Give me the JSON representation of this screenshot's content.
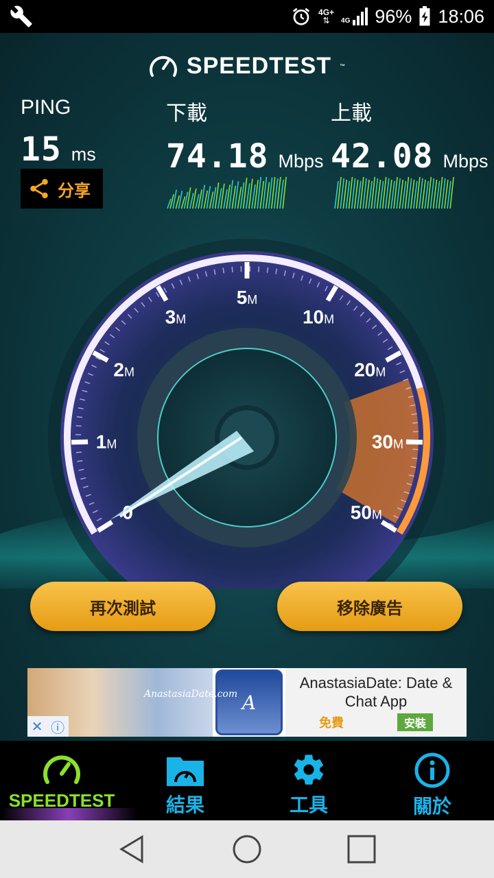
{
  "status_bar": {
    "network_top": "4G+",
    "network_secondary": "4G",
    "battery": "96%",
    "time": "18:06"
  },
  "brand": {
    "name": "SPEEDTEST",
    "tm": "™"
  },
  "ping": {
    "label": "PING",
    "value": "15",
    "unit": "ms"
  },
  "download": {
    "label": "下載",
    "value": "74.18",
    "unit": "Mbps"
  },
  "upload": {
    "label": "上載",
    "value": "42.08",
    "unit": "Mbps"
  },
  "share": {
    "label": "分享"
  },
  "gauge": {
    "ticks": [
      {
        "label": "0",
        "suffix": ""
      },
      {
        "label": "1",
        "suffix": "M"
      },
      {
        "label": "2",
        "suffix": "M"
      },
      {
        "label": "3",
        "suffix": "M"
      },
      {
        "label": "5",
        "suffix": "M"
      },
      {
        "label": "10",
        "suffix": "M"
      },
      {
        "label": "20",
        "suffix": "M"
      },
      {
        "label": "30",
        "suffix": "M"
      },
      {
        "label": "50",
        "suffix": "M"
      }
    ]
  },
  "buttons": {
    "retest": "再次測試",
    "remove_ads": "移除廣告"
  },
  "ad": {
    "logo": "AnastasiaDate.com",
    "icon_letter": "A",
    "title": "AnastasiaDate: Date & Chat App",
    "free": "免費",
    "install": "安裝",
    "close_glyph": "✕",
    "info_glyph": "ⓘ"
  },
  "nav": {
    "items": [
      {
        "label": "SPEEDTEST",
        "icon": "speedometer-icon"
      },
      {
        "label": "結果",
        "icon": "folder-gauge-icon"
      },
      {
        "label": "工具",
        "icon": "gear-icon"
      },
      {
        "label": "關於",
        "icon": "info-icon"
      }
    ]
  },
  "colors": {
    "accent_green": "#8be02c",
    "accent_blue": "#1ab3e8",
    "accent_orange": "#f6a623"
  }
}
